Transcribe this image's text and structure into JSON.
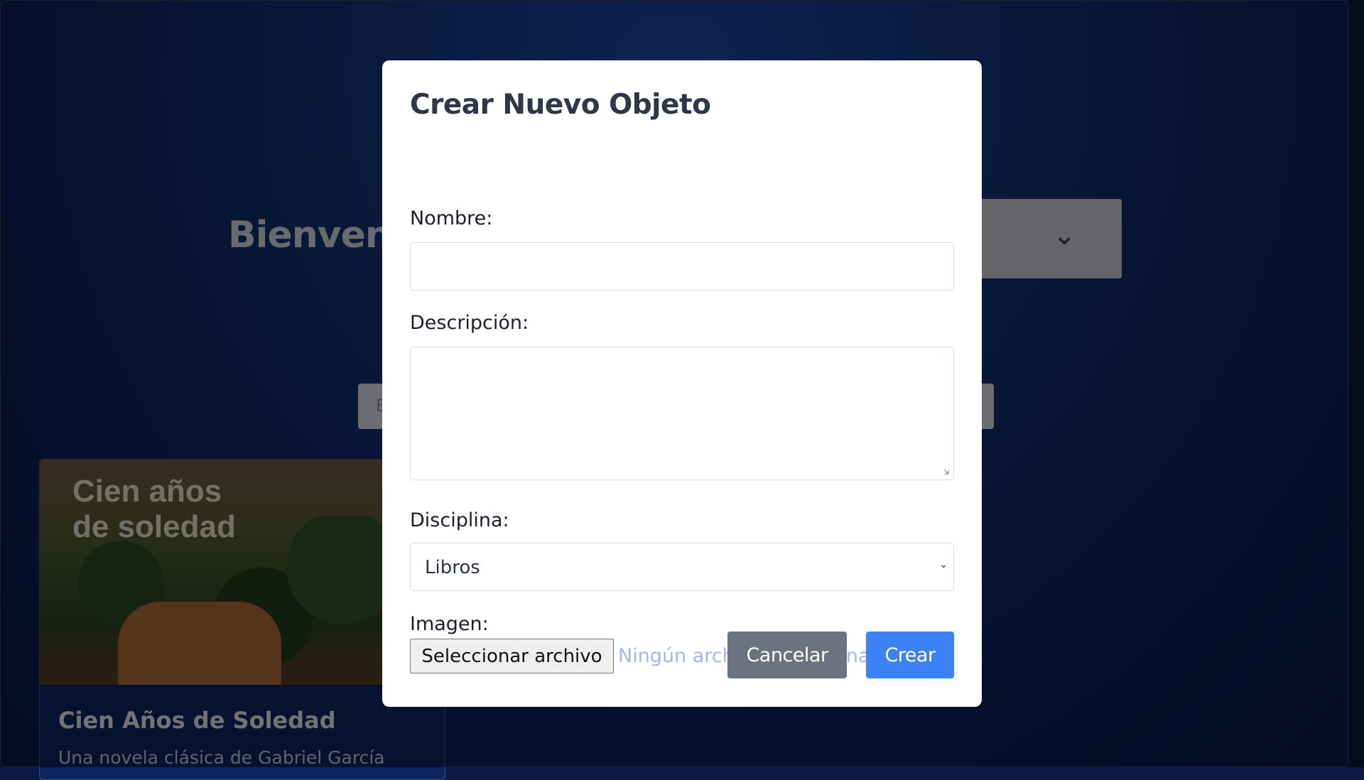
{
  "background": {
    "welcome_text": "Bienvenido",
    "search_placeholder": "B",
    "card": {
      "cover_title_line1": "Cien años",
      "cover_title_line2": "de soledad",
      "title": "Cien Años de Soledad",
      "description": "Una novela clásica de Gabriel García"
    }
  },
  "modal": {
    "title": "Crear Nuevo Objeto",
    "name_label": "Nombre:",
    "name_value": "",
    "description_label": "Descripción:",
    "description_value": "",
    "discipline_label": "Disciplina:",
    "discipline_selected": "Libros",
    "image_label": "Imagen:",
    "file_button_label": "Seleccionar archivo",
    "file_status": "Ningún archivo seleccionado",
    "cancel_label": "Cancelar",
    "create_label": "Crear"
  },
  "colors": {
    "primary": "#3b82f6",
    "secondary": "#6b7280",
    "heading": "#2d3748",
    "file_status": "#a9b3ee"
  }
}
